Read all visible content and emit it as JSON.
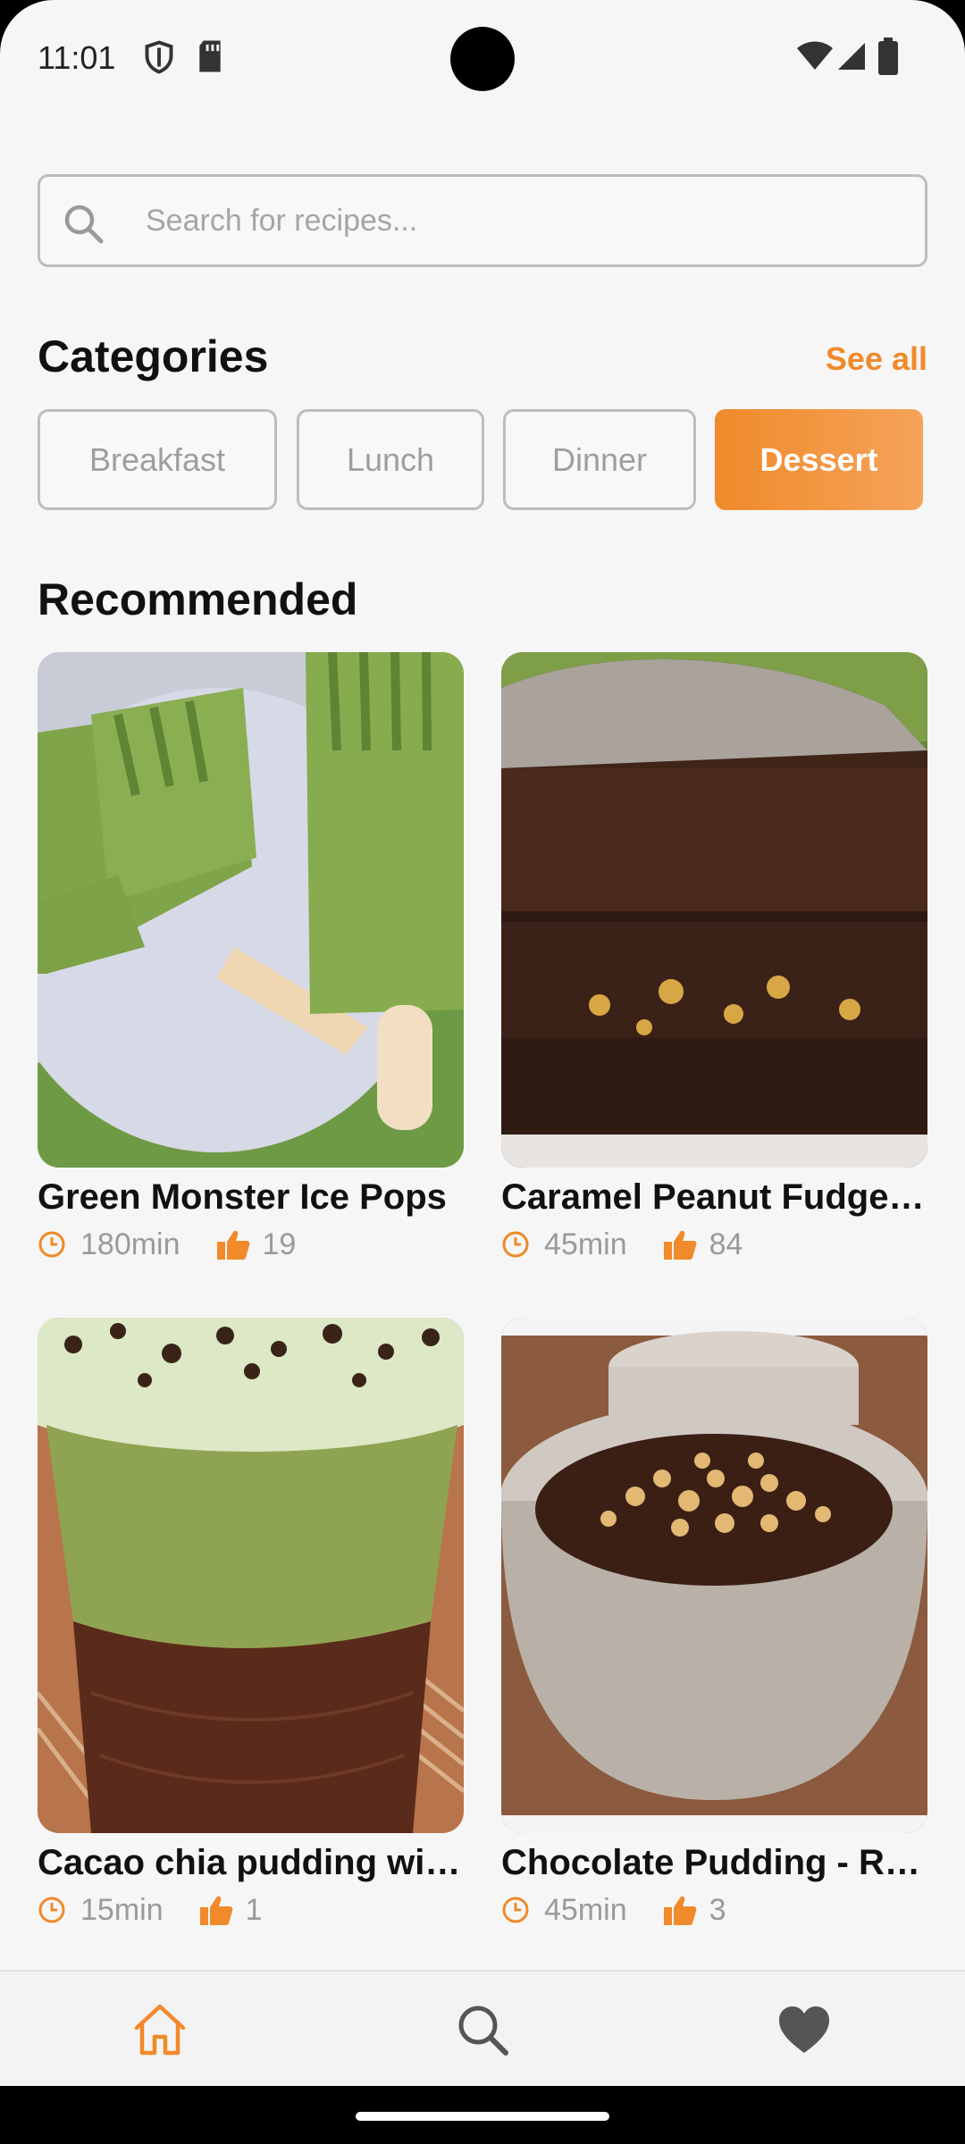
{
  "status_bar": {
    "time": "11:01"
  },
  "search": {
    "placeholder": "Search for recipes..."
  },
  "categories": {
    "title": "Categories",
    "see_all": "See all",
    "items": [
      {
        "label": "Breakfast",
        "selected": false
      },
      {
        "label": "Lunch",
        "selected": false
      },
      {
        "label": "Dinner",
        "selected": false
      },
      {
        "label": "Dessert",
        "selected": true
      }
    ]
  },
  "recommended": {
    "title": "Recommended",
    "recipes": [
      {
        "title": "Green Monster Ice Pops",
        "time": "180min",
        "likes": "19"
      },
      {
        "title": "Caramel Peanut Fudge Cake",
        "time": "45min",
        "likes": "84"
      },
      {
        "title": "Cacao chia pudding with avocado",
        "time": "15min",
        "likes": "1"
      },
      {
        "title": "Chocolate Pudding - Raw Vegan",
        "time": "45min",
        "likes": "3"
      }
    ]
  },
  "bottom_nav": {
    "items": [
      {
        "icon": "home-icon",
        "active": true
      },
      {
        "icon": "search-icon",
        "active": false
      },
      {
        "icon": "heart-icon",
        "active": false
      }
    ]
  },
  "colors": {
    "accent": "#F08A2A",
    "background": "#F6F6F6"
  }
}
